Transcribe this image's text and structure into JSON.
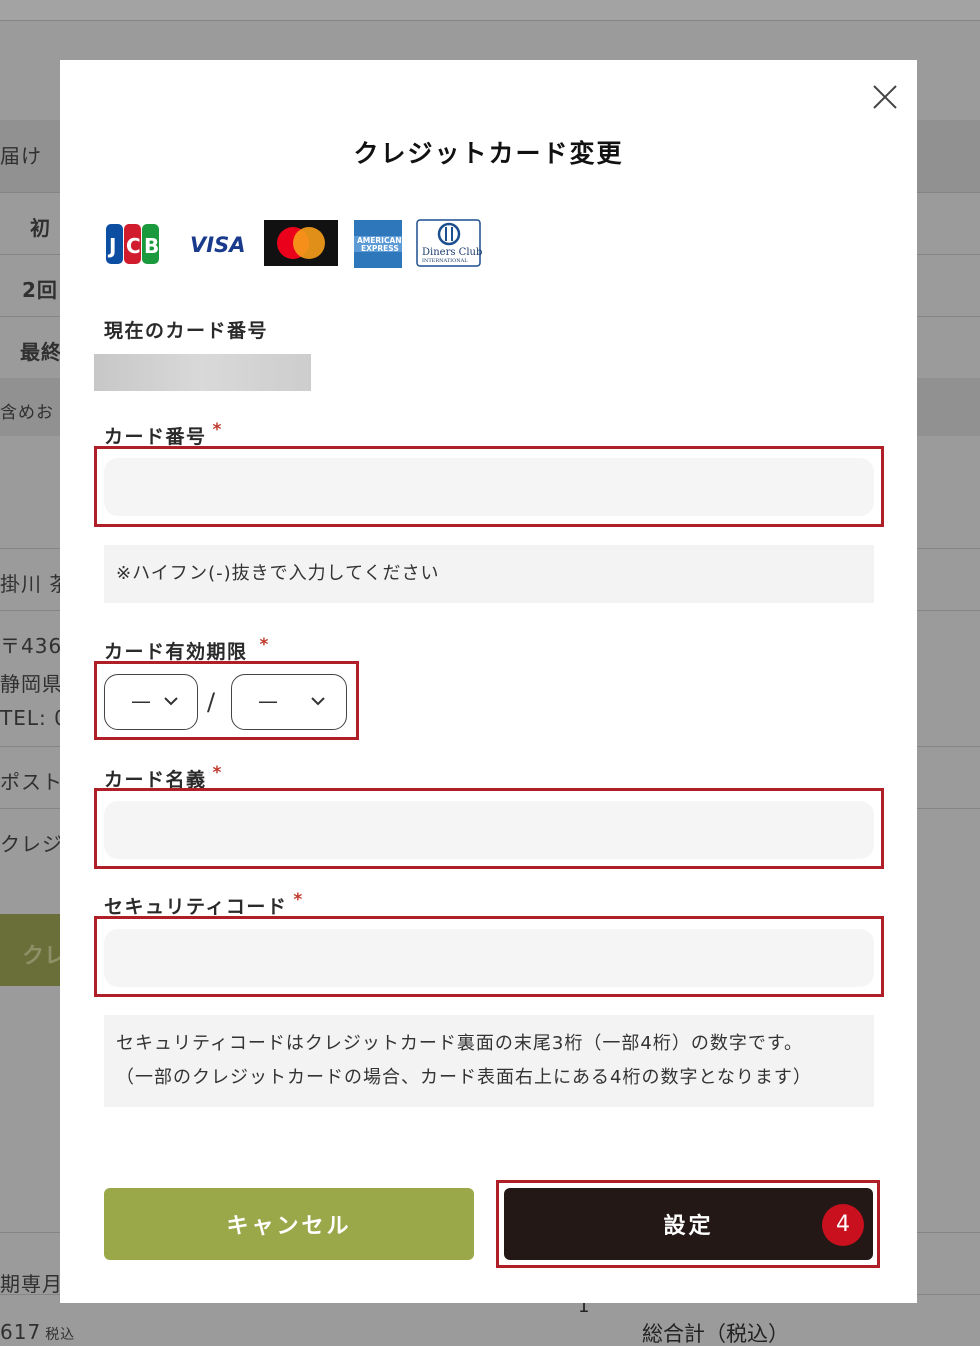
{
  "background": {
    "rows": [
      "届け",
      "初",
      "2回",
      "最終",
      "含めお",
      "掛川 茶",
      "〒436-",
      "静岡県",
      "TEL: 0",
      "ポスト",
      "クレジ"
    ],
    "green_button_label": "クレ",
    "footer_left": "期専月",
    "footer_price": "617",
    "footer_price_suffix": "税込",
    "footer_qty": "1",
    "footer_total_label": "総合計（税込）"
  },
  "modal": {
    "title": "クレジットカード変更",
    "card_brands": [
      "JCB",
      "VISA",
      "Mastercard",
      "American Express",
      "Diners Club International"
    ],
    "current_card": {
      "label": "現在のカード番号"
    },
    "card_number": {
      "label": "カード番号",
      "required_mark": "*",
      "value": "",
      "hint": "※ハイフン(-)抜きで入力してください"
    },
    "expiry": {
      "label": "カード有効期限",
      "required_mark": "*",
      "month_value": "—",
      "year_value": "—",
      "separator": "/"
    },
    "card_name": {
      "label": "カード名義",
      "required_mark": "*",
      "value": ""
    },
    "security_code": {
      "label": "セキュリティコード",
      "required_mark": "*",
      "value": "",
      "hint_line1": "セキュリティコードはクレジットカード裏面の末尾3桁（一部4桁）の数字です。",
      "hint_line2": "（一部のクレジットカードの場合、カード表面右上にある4桁の数字となります）"
    },
    "buttons": {
      "cancel": "キャンセル",
      "submit": "設定"
    },
    "step_badge": "4"
  },
  "colors": {
    "accent_red": "#b01e28",
    "cancel_green": "#9aa84a",
    "submit_dark": "#231816",
    "badge_red": "#c8101e"
  }
}
